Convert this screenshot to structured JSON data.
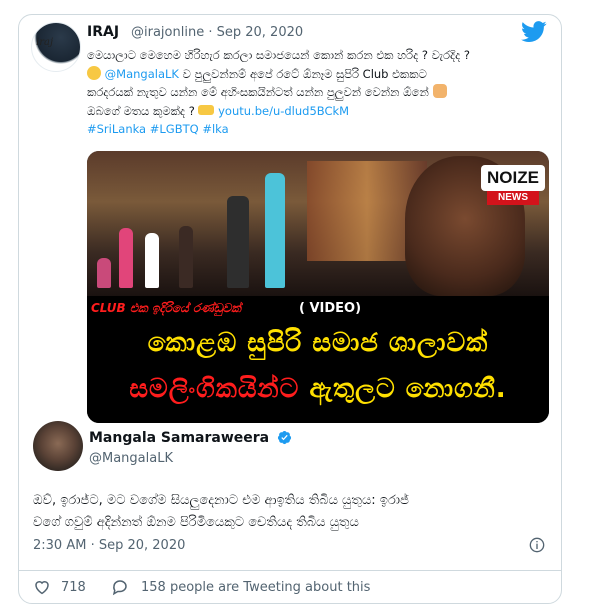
{
  "quoted_tweet": {
    "author_name": "IRAJ",
    "handle": "@irajonline",
    "date": "Sep 20, 2020",
    "avatar_signature": "iraj",
    "text_line1": "මෙයාලාට මෙහෙම හිරිහැර කරලා සමාජයෙන් කොන් කරන එක හරිද ? වැරදිද ?",
    "mention": "@MangalaLK",
    "text_line2": "ව පුලුවන්නම් අපේ රටේ ඕනෑම සුපිරි Club එකකට",
    "text_line3": "කරදරයක් නැතුව යන්න මේ අහිංසකයින්ටත් යන්න පුලුවන් වෙන්න ඕනේ",
    "text_line4": "ඔබගේ මතය කුමක්ද ?",
    "link": "youtu.be/u-dlud5BCkM",
    "hashtags": "#SriLanka #LGBTQ #lka",
    "media": {
      "brand_top": "NOIZE",
      "brand_bottom": "NEWS",
      "strip_red": "CLUB එක ඉදිරියේ රණ්ඩුවක්",
      "strip_white": "( VIDEO)",
      "headline_1": "කොළඹ සුපිරි සමාජ ශාලාවක්",
      "headline_2_red": "සමලිංගිකයින්ට",
      "headline_2_yellow": "ඇතුලට නොගනී."
    }
  },
  "main_tweet": {
    "author_name": "Mangala Samaraweera",
    "handle": "@MangalaLK",
    "text_line1": "ඔව්, ඉරාජ්ට, මට වගේම සියලුදෙනාට එම ආඉතිය තිබිය යුතුය: ඉරාජ්",
    "text_line2": "වගේ ගවුම් අදින්නත් ඕනම පිරිමියෙකුට චෙතියද තිබිය යුතුය",
    "timestamp": "2:30 AM · Sep 20, 2020",
    "likes": "718",
    "tweeting_about": "158 people are Tweeting about this"
  },
  "colors": {
    "link_blue": "#1d9bf0",
    "secondary_text": "#536471",
    "border": "#cfd9de",
    "media_yellow": "#ffe000",
    "media_red": "#ff1d1d"
  },
  "icons": [
    "twitter-bird-icon",
    "verified-badge-icon",
    "info-icon",
    "heart-icon",
    "reply-bubble-icon",
    "emoji-icon",
    "pointing-hand-icon",
    "shrug-emoji-icon"
  ]
}
